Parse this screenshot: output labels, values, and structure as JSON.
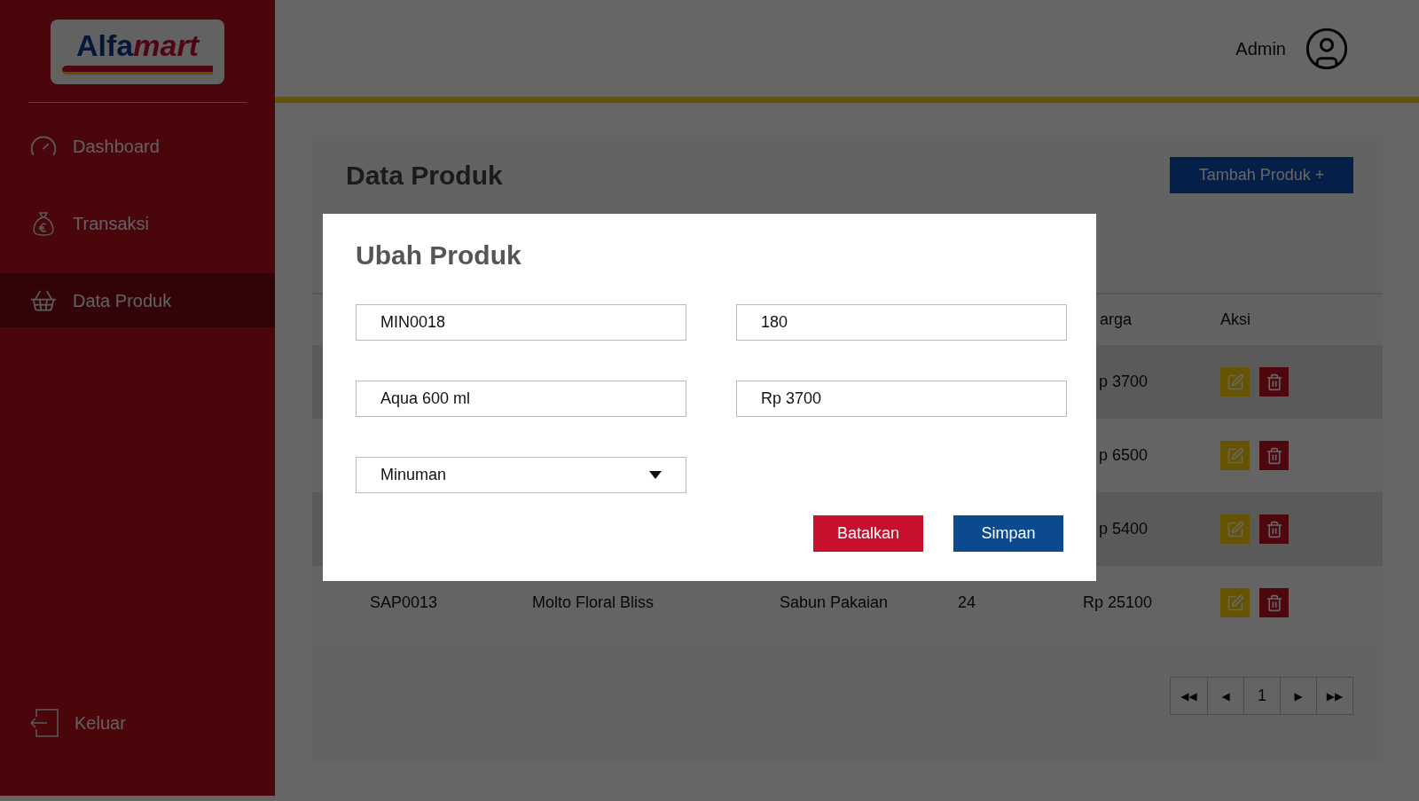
{
  "sidebar": {
    "logo": [
      "Alfa",
      "mart"
    ],
    "items": [
      {
        "label": "Dashboard",
        "kind": "gauge",
        "selected": false
      },
      {
        "label": "Transaksi",
        "kind": "moneybag",
        "selected": false
      },
      {
        "label": "Data Produk",
        "kind": "basket",
        "selected": true
      }
    ],
    "logout": {
      "label": "Keluar"
    }
  },
  "header": {
    "user": "Admin"
  },
  "page": {
    "title": "Data Produk",
    "add_button": "Tambah Produk +",
    "table": {
      "columns": [
        "arga",
        "Aksi"
      ],
      "rows": [
        {
          "cells": [
            "p 3700"
          ]
        },
        {
          "cells": [
            "p 6500"
          ]
        },
        {
          "cells": [
            "p 5400"
          ]
        },
        {
          "cells": [
            "SAP0013",
            "Molto Floral Bliss",
            "Sabun Pakaian",
            "24",
            "Rp 25100"
          ]
        }
      ]
    },
    "pagination": {
      "first": "◀◀",
      "prev": "◀",
      "page": "1",
      "next": "▶",
      "last": "▶▶"
    }
  },
  "modal": {
    "title": "Ubah Produk",
    "fields": [
      {
        "kind": "text",
        "value": "MIN0018"
      },
      {
        "kind": "text",
        "value": "180"
      },
      {
        "kind": "text",
        "value": "Aqua 600 ml"
      },
      {
        "kind": "text",
        "value": "Rp 3700"
      },
      {
        "kind": "select",
        "value": "Minuman"
      }
    ],
    "buttons": [
      {
        "label": "Batalkan",
        "kind": "cancel"
      },
      {
        "label": "Simpan",
        "kind": "save"
      }
    ]
  }
}
